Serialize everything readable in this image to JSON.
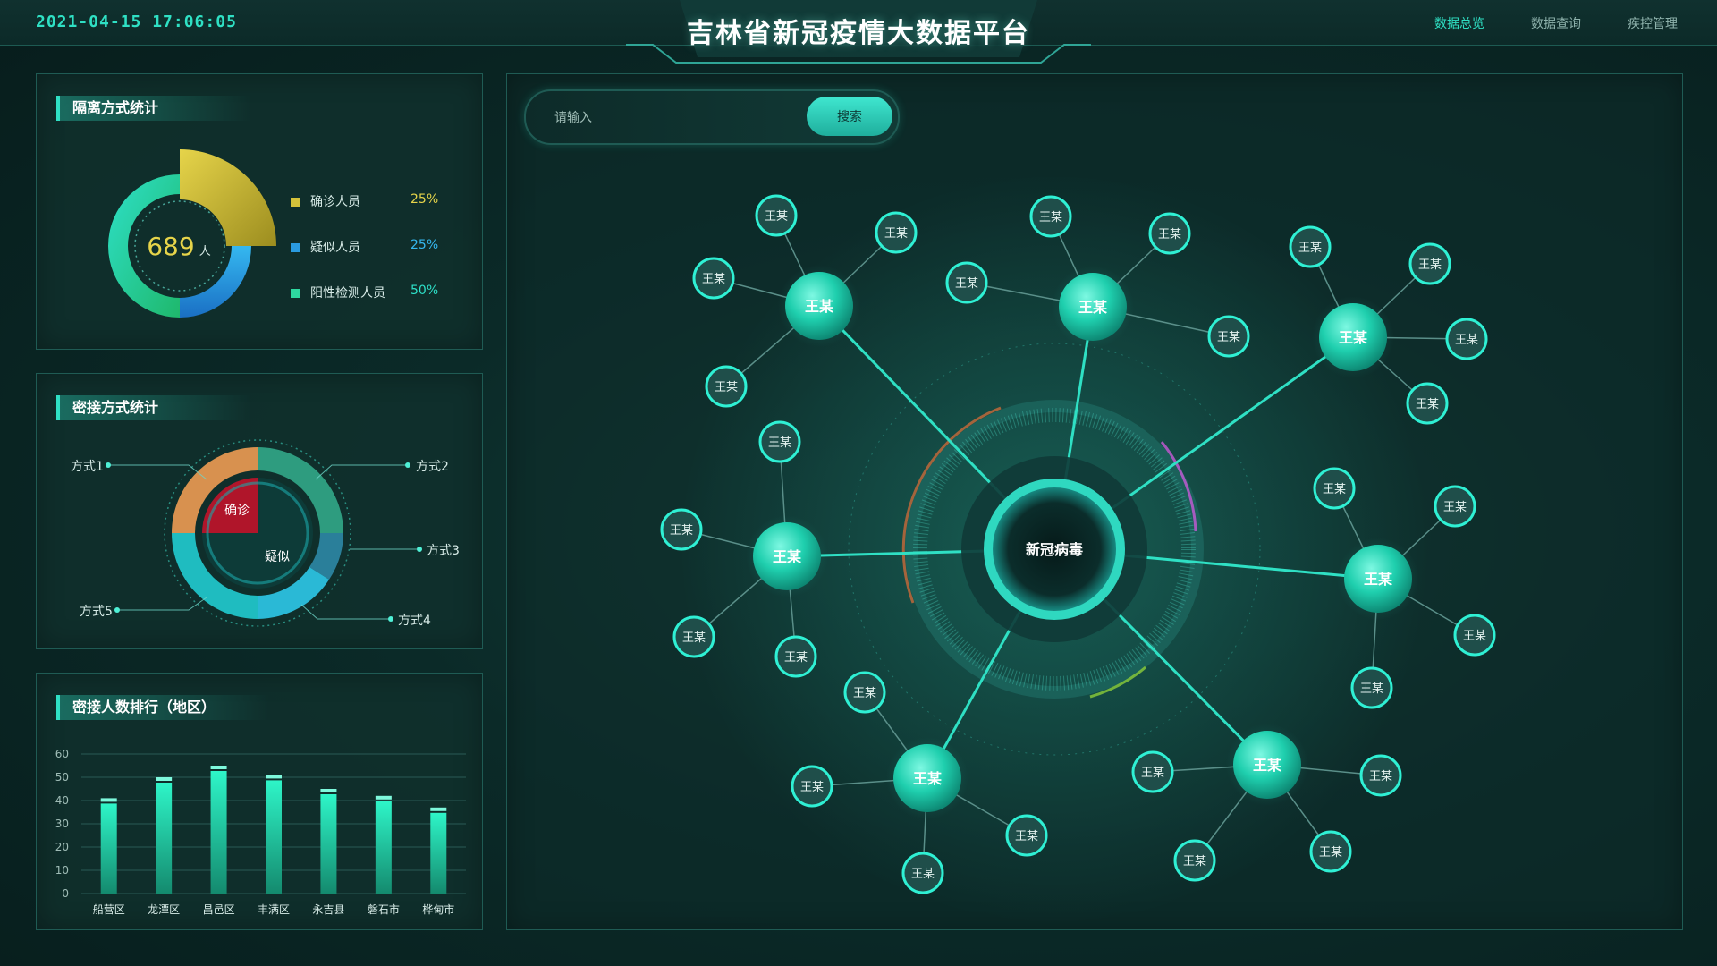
{
  "header": {
    "datetime": "2021-04-15 17:06:05",
    "title": "吉林省新冠疫情大数据平台",
    "nav": [
      "数据总览",
      "数据查询",
      "疾控管理"
    ],
    "active_nav": 0
  },
  "quarantine": {
    "title": "隔离方式统计",
    "total": "689",
    "unit": "人",
    "items": [
      {
        "label": "确诊人员",
        "pct": "25%",
        "color": "#d4c23a"
      },
      {
        "label": "疑似人员",
        "pct": "25%",
        "color": "#2a9be0"
      },
      {
        "label": "阳性检测人员",
        "pct": "50%",
        "color": "#2ed8a0"
      }
    ]
  },
  "contact": {
    "title": "密接方式统计",
    "inner_labels": [
      "确诊",
      "疑似"
    ],
    "outer_labels": [
      "方式1",
      "方式2",
      "方式3",
      "方式4",
      "方式5"
    ]
  },
  "ranking": {
    "title": "密接人数排行（地区）",
    "chart_data": {
      "type": "bar",
      "categories": [
        "船营区",
        "龙潭区",
        "昌邑区",
        "丰满区",
        "永吉县",
        "磐石市",
        "桦甸市"
      ],
      "values": [
        41,
        50,
        55,
        51,
        45,
        42,
        37
      ],
      "yticks": [
        "0",
        "10",
        "20",
        "30",
        "40",
        "50",
        "60"
      ],
      "ylim": [
        0,
        60
      ]
    }
  },
  "search": {
    "placeholder": "请输入",
    "button": "搜索"
  },
  "graph": {
    "center": "新冠病毒",
    "hub_label": "王某",
    "leaf_label": "王某"
  }
}
